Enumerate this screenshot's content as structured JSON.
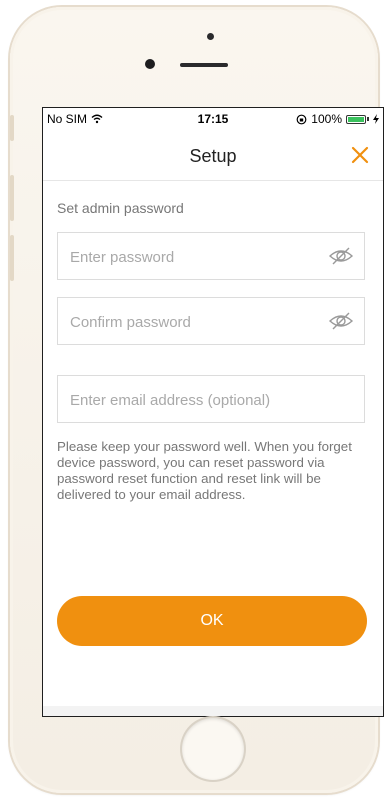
{
  "status_bar": {
    "carrier": "No SIM",
    "time": "17:15",
    "battery": "100%",
    "battery_level": 1.0,
    "battery_color": "#3ac15d"
  },
  "nav": {
    "title": "Setup",
    "close_icon": "close-icon",
    "accent_color": "#f0900f"
  },
  "form": {
    "section_label": "Set admin password",
    "password_placeholder": "Enter password",
    "confirm_placeholder": "Confirm password",
    "email_placeholder": "Enter email address (optional)",
    "password_value": "",
    "confirm_value": "",
    "email_value": "",
    "visibility_icon": "eye-off-icon"
  },
  "info_text": "Please keep your password well. When you forget device password, you can reset password via password reset function and reset link will be delivered to your email address.",
  "ok_label": "OK"
}
